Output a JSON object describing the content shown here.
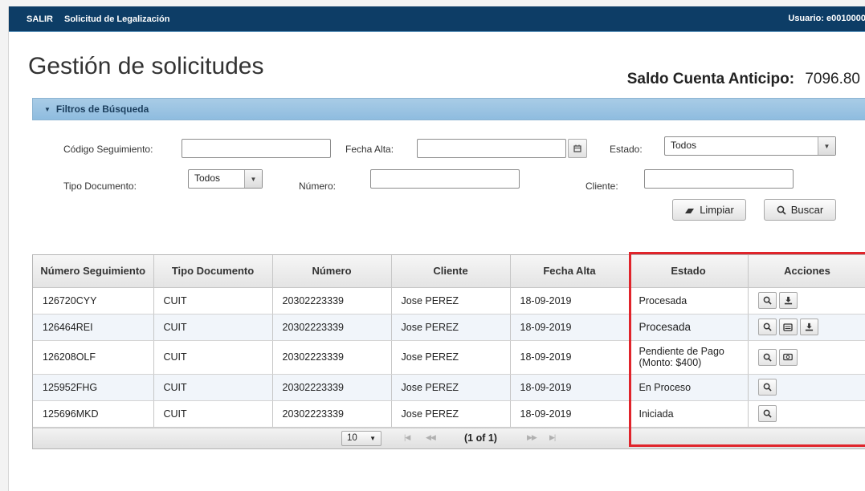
{
  "topbar": {
    "salir_label": "SALIR",
    "app_title": "Solicitud de Legalización",
    "user_label": "Usuario: e0010000"
  },
  "page": {
    "title": "Gestión de solicitudes",
    "saldo_label": "Saldo Cuenta Anticipo:",
    "saldo_value": "7096.80"
  },
  "filters": {
    "panel_title": "Filtros de Búsqueda",
    "codigo_label": "Código Seguimiento:",
    "codigo_value": "",
    "fecha_label": "Fecha Alta:",
    "fecha_value": "",
    "estado_label": "Estado:",
    "estado_value": "Todos",
    "tipo_label": "Tipo Documento:",
    "tipo_value": "Todos",
    "numero_label": "Número:",
    "numero_value": "",
    "cliente_label": "Cliente:",
    "cliente_value": "",
    "limpiar_label": "Limpiar",
    "buscar_label": "Buscar"
  },
  "table": {
    "headers": {
      "seguimiento": "Número Seguimiento",
      "tipo": "Tipo Documento",
      "numero": "Número",
      "cliente": "Cliente",
      "fecha": "Fecha Alta",
      "estado": "Estado",
      "acciones": "Acciones"
    },
    "rows": [
      {
        "seguimiento": "126720CYY",
        "tipo": "CUIT",
        "numero": "20302223339",
        "cliente": "Jose PEREZ",
        "fecha": "18-09-2019",
        "estado": "Procesada",
        "estado2": "",
        "actions": [
          "magnifier-icon",
          "download-icon"
        ]
      },
      {
        "seguimiento": "126464REI",
        "tipo": "CUIT",
        "numero": "20302223339",
        "cliente": "Jose PEREZ",
        "fecha": "18-09-2019",
        "estado": "Procesada",
        "estado2": "",
        "actions": [
          "magnifier-icon",
          "document-icon",
          "download-icon"
        ]
      },
      {
        "seguimiento": "126208OLF",
        "tipo": "CUIT",
        "numero": "20302223339",
        "cliente": "Jose PEREZ",
        "fecha": "18-09-2019",
        "estado": "Pendiente de Pago",
        "estado2": "(Monto: $400)",
        "actions": [
          "magnifier-icon",
          "money-icon"
        ]
      },
      {
        "seguimiento": "125952FHG",
        "tipo": "CUIT",
        "numero": "20302223339",
        "cliente": "Jose PEREZ",
        "fecha": "18-09-2019",
        "estado": "En Proceso",
        "estado2": "",
        "actions": [
          "magnifier-icon"
        ]
      },
      {
        "seguimiento": "125696MKD",
        "tipo": "CUIT",
        "numero": "20302223339",
        "cliente": "Jose PEREZ",
        "fecha": "18-09-2019",
        "estado": "Iniciada",
        "estado2": "",
        "actions": [
          "magnifier-icon"
        ]
      }
    ]
  },
  "paginator": {
    "rows_per_page": "10",
    "page_report": "(1 of 1)"
  },
  "colors": {
    "topbar": "#0d3d66",
    "panel_header": "#9cc4e4",
    "highlight": "#e0242b"
  }
}
